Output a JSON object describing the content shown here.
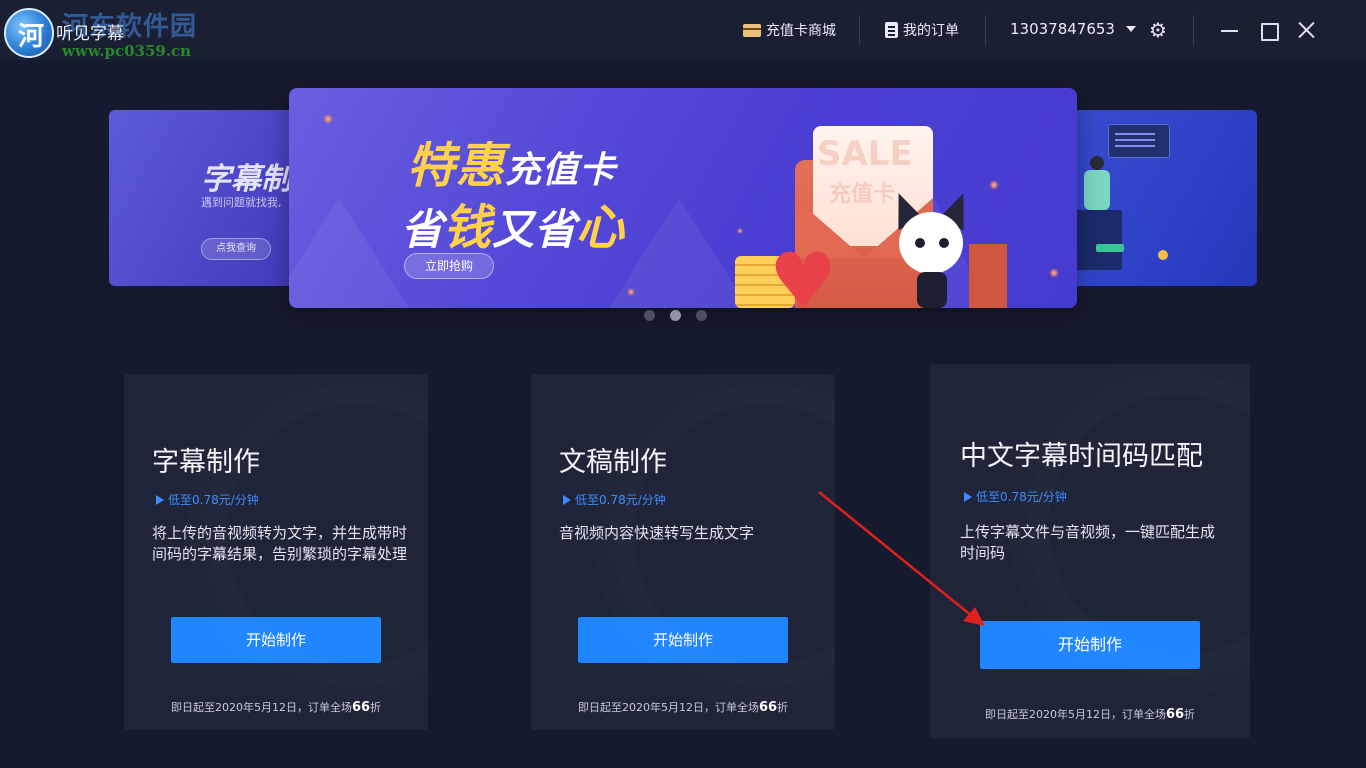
{
  "app": {
    "title": "听见字幕",
    "watermark_site": "河东软件园",
    "watermark_url": "www.pc0359.cn"
  },
  "titlebar": {
    "recharge_store": "充值卡商城",
    "my_orders": "我的订单",
    "account": "13037847653",
    "icons": [
      "card-icon",
      "order-icon",
      "caret-down-icon",
      "gear-icon",
      "minimize-icon",
      "maximize-icon",
      "close-icon"
    ]
  },
  "carousel": {
    "main": {
      "line1_gold": "特惠",
      "line1_white": "充值卡",
      "line2_white_a": "省",
      "line2_gold": "钱",
      "line2_white_b": "又省",
      "line2_gold_b": "心",
      "button": "立即抢购",
      "sale_text": "SALE",
      "sale_sub": "充值卡"
    },
    "left": {
      "title": "字幕制",
      "subtitle": "遇到问题就找我,",
      "button": "点我查询"
    },
    "active_index": 1,
    "count": 3
  },
  "products": [
    {
      "title": "字幕制作",
      "price": "低至0.78元/分钟",
      "description": "将上传的音视频转为文字，并生成带时间码的字幕结果，告别繁琐的字幕处理",
      "button": "开始制作",
      "note_prefix": "即日起至2020年5月12日，订单全场",
      "note_highlight": "66",
      "note_suffix": "折"
    },
    {
      "title": "文稿制作",
      "price": "低至0.78元/分钟",
      "description": "音视频内容快速转写生成文字",
      "button": "开始制作",
      "note_prefix": "即日起至2020年5月12日，订单全场",
      "note_highlight": "66",
      "note_suffix": "折"
    },
    {
      "title": "中文字幕时间码匹配",
      "price": "低至0.78元/分钟",
      "description": "上传字幕文件与音视频，一键匹配生成时间码",
      "button": "开始制作",
      "note_prefix": "即日起至2020年5月12日，订单全场",
      "note_highlight": "66",
      "note_suffix": "折"
    }
  ],
  "colors": {
    "background": "#161a2e",
    "titlebar": "#1b1f33",
    "card": "#1f2438",
    "accent": "#1f86ff",
    "price": "#3d8bff",
    "promo_gold": "#ffd24a",
    "annotation_arrow": "#e0201c"
  }
}
